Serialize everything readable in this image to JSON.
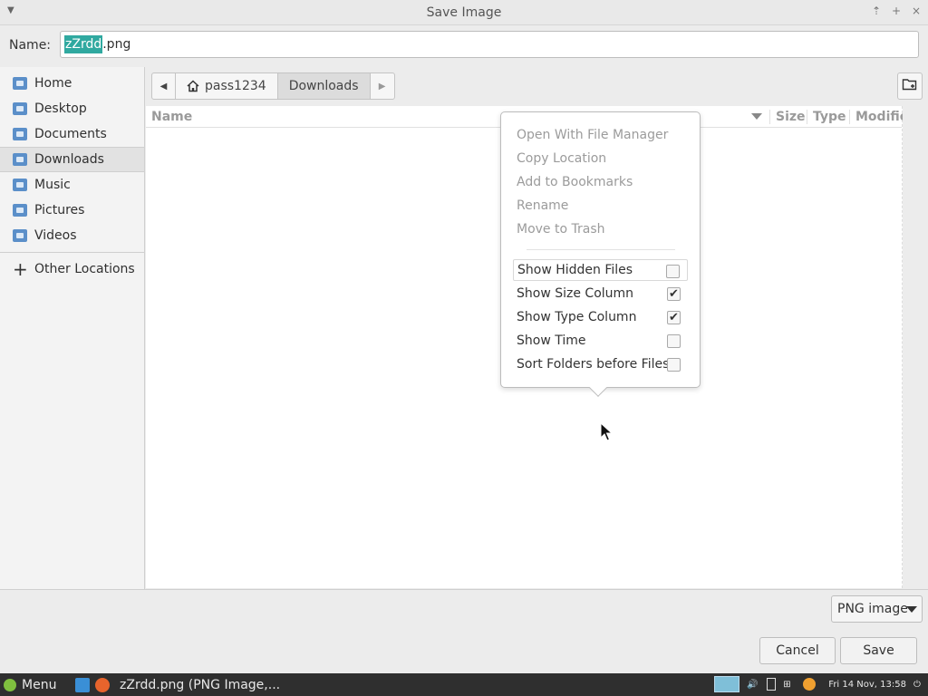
{
  "window": {
    "title": "Save Image"
  },
  "name_row": {
    "label": "Name:",
    "value_selected": "zZrdd",
    "value_rest": ".png"
  },
  "sidebar": {
    "items": [
      {
        "label": "Home",
        "icon": "home-folder-icon"
      },
      {
        "label": "Desktop",
        "icon": "desktop-folder-icon"
      },
      {
        "label": "Documents",
        "icon": "documents-folder-icon"
      },
      {
        "label": "Downloads",
        "icon": "downloads-folder-icon"
      },
      {
        "label": "Music",
        "icon": "music-folder-icon"
      },
      {
        "label": "Pictures",
        "icon": "pictures-folder-icon"
      },
      {
        "label": "Videos",
        "icon": "videos-folder-icon"
      }
    ],
    "other_locations": "Other Locations"
  },
  "pathbar": {
    "home": "pass1234",
    "current": "Downloads"
  },
  "columns": {
    "name": "Name",
    "size": "Size",
    "type": "Type",
    "modified": "Modifie"
  },
  "popover": {
    "actions": [
      "Open With File Manager",
      "Copy Location",
      "Add to Bookmarks",
      "Rename",
      "Move to Trash"
    ],
    "toggles": [
      {
        "label": "Show Hidden Files",
        "checked": false
      },
      {
        "label": "Show Size Column",
        "checked": true
      },
      {
        "label": "Show Type Column",
        "checked": true
      },
      {
        "label": "Show Time",
        "checked": false
      },
      {
        "label": "Sort Folders before Files",
        "checked": false
      }
    ]
  },
  "footer": {
    "filter": "PNG image",
    "cancel": "Cancel",
    "save": "Save"
  },
  "taskbar": {
    "menu": "Menu",
    "task": "zZrdd.png (PNG Image,...",
    "clock": "Fri 14 Nov, 13:58"
  },
  "colors": {
    "selection": "#30a9a0",
    "folder": "#5b8fc9",
    "taskbar": "#2f2f2f"
  }
}
